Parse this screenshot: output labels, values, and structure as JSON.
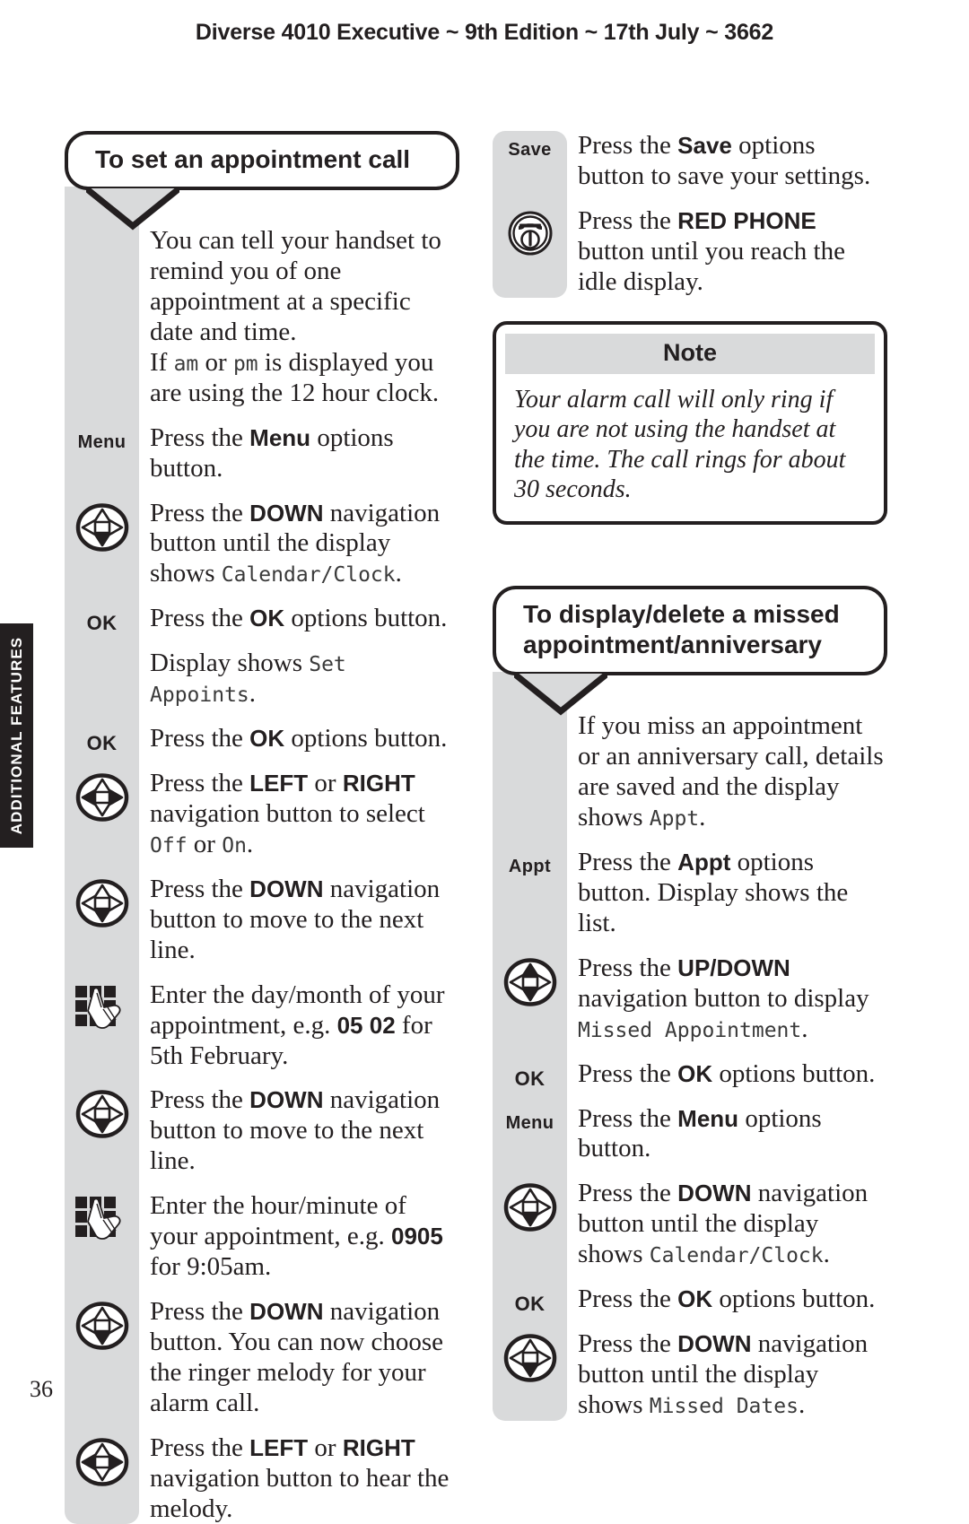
{
  "header": {
    "running_head": "Diverse 4010 Executive ~ 9th Edition ~ 17th July ~ 3662"
  },
  "side_tab": {
    "label": "ADDITIONAL FEATURES"
  },
  "footer": {
    "page_number": "36"
  },
  "colors": {
    "ink": "#231f20",
    "rail_gray": "#d9dadb",
    "lcd_text": "#3a3a3a",
    "paper": "#ffffff"
  },
  "left_column": {
    "heading": "To set an appointment call",
    "steps": [
      {
        "icon": "none",
        "softkey": "",
        "text_html": "You can tell your handset to remind you of one appointment at a specific date and time.<br>If <span class=\"lcd\">am</span> or <span class=\"lcd\">pm</span> is displayed you are using the 12 hour clock."
      },
      {
        "icon": "softkey",
        "softkey": "Menu",
        "text_html": "Press the <b class=\"kw\">Menu</b> options button."
      },
      {
        "icon": "navpad-down",
        "softkey": "",
        "text_html": "Press the <b class=\"kw\">DOWN</b> navigation button until the display shows <span class=\"lcd\">Calendar/Clock</span>."
      },
      {
        "icon": "softkey-ok",
        "softkey": "OK",
        "text_html": "Press the <b class=\"kw\">OK</b> options button."
      },
      {
        "icon": "none",
        "softkey": "",
        "text_html": "Display shows <span class=\"lcd\">Set Appoints</span>."
      },
      {
        "icon": "softkey-ok",
        "softkey": "OK",
        "text_html": "Press the <b class=\"kw\">OK</b> options button."
      },
      {
        "icon": "navpad-leftright",
        "softkey": "",
        "text_html": "Press the <b class=\"kw\">LEFT</b> or <b class=\"kw\">RIGHT</b> navigation button to select <span class=\"lcd\">Off</span> or <span class=\"lcd\">On</span>."
      },
      {
        "icon": "navpad-down",
        "softkey": "",
        "text_html": "Press the <b class=\"kw\">DOWN</b> navigation button to move to the next line."
      },
      {
        "icon": "keypad",
        "softkey": "",
        "text_html": "Enter the day/month of your appointment, e.g. <b class=\"kw\">05 02</b> for 5th February."
      },
      {
        "icon": "navpad-down",
        "softkey": "",
        "text_html": "Press the <b class=\"kw\">DOWN</b> navigation button to move to the next line."
      },
      {
        "icon": "keypad",
        "softkey": "",
        "text_html": "Enter the hour/minute of your appointment, e.g. <b class=\"kw\">0905</b> for 9:05am."
      },
      {
        "icon": "navpad-down",
        "softkey": "",
        "text_html": "Press the <b class=\"kw\">DOWN</b> navigation button. You can now choose the ringer melody for your alarm call."
      },
      {
        "icon": "navpad-leftright",
        "softkey": "",
        "text_html": "Press the <b class=\"kw\">LEFT</b> or <b class=\"kw\">RIGHT</b> navigation button to hear the melody."
      }
    ]
  },
  "right_column": {
    "save_block_steps": [
      {
        "icon": "softkey",
        "softkey": "Save",
        "text_html": "Press the <b class=\"kw\">Save</b> options button to save your settings."
      },
      {
        "icon": "redphone",
        "softkey": "",
        "text_html": "Press the <b class=\"kw\">RED PHONE</b> button until you reach the idle display."
      }
    ],
    "note": {
      "title": "Note",
      "body": "Your alarm call will only ring if you are not using the handset at the time. The call rings for about 30 seconds."
    },
    "heading": "To display/delete a missed appointment/anniversary",
    "steps": [
      {
        "icon": "none",
        "softkey": "",
        "text_html": "If you miss an appointment or an anniversary call, details are saved and the display shows <span class=\"lcd\">Appt</span>."
      },
      {
        "icon": "softkey",
        "softkey": "Appt",
        "text_html": "Press the <b class=\"kw\">Appt</b> options button. Display shows the list."
      },
      {
        "icon": "navpad-updown",
        "softkey": "",
        "text_html": "Press the <b class=\"kw\">UP/DOWN</b> navigation button to display <span class=\"lcd\">Missed Appointment</span>."
      },
      {
        "icon": "softkey-ok",
        "softkey": "OK",
        "text_html": "Press the <b class=\"kw\">OK</b> options button."
      },
      {
        "icon": "softkey",
        "softkey": "Menu",
        "text_html": "Press the <b class=\"kw\">Menu</b> options button."
      },
      {
        "icon": "navpad-down",
        "softkey": "",
        "text_html": "Press the <b class=\"kw\">DOWN</b> navigation button until the display shows <span class=\"lcd\">Calendar/Clock</span>."
      },
      {
        "icon": "softkey-ok",
        "softkey": "OK",
        "text_html": "Press the <b class=\"kw\">OK</b> options button."
      },
      {
        "icon": "navpad-down",
        "softkey": "",
        "text_html": "Press the <b class=\"kw\">DOWN</b> navigation button until the display shows <span class=\"lcd\">Missed Dates</span>."
      }
    ]
  }
}
